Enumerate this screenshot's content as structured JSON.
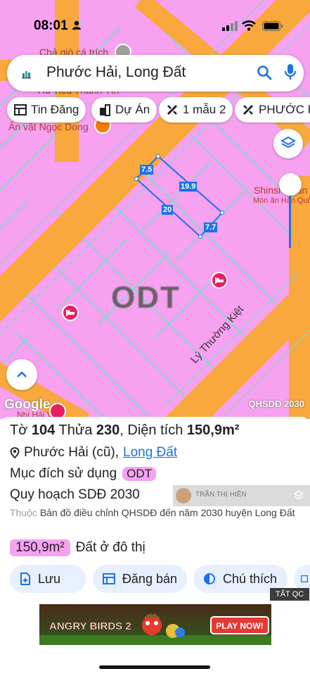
{
  "status": {
    "time": "08:01"
  },
  "search": {
    "text": "Phước Hải, Long Đất"
  },
  "chips": [
    {
      "label": "Tin Đăng"
    },
    {
      "label": "Dự Án"
    },
    {
      "label": "1 mẫu 2"
    },
    {
      "label": "PHƯỚC H"
    }
  ],
  "map": {
    "labels": {
      "cha_gio": "Chả giò cá trích",
      "hu_tieu": "Hủ Tiếu Thanh Tín",
      "an_vat": "Ăn vặt Ngọc Dong",
      "shinsi": "Shinsi Quán",
      "mon_an": "Món ăn Hàn Quốc",
      "nhi": "Nhi Hải Vy"
    },
    "zone": "ODT",
    "street": "Lý Thường Kiệt",
    "dimensions": {
      "top": "7.5",
      "right_top": "19.9",
      "left": "20",
      "right": "7.7"
    },
    "google": "Google",
    "tag": "QHSDĐ 2030",
    "colors": {
      "land": "#f7a1f1",
      "road": "#f8a83c",
      "grid": "#86d7d2",
      "accent": "#1a73e8"
    }
  },
  "sheet": {
    "to_label": "Tờ",
    "to_value": "104",
    "thua_label": "Thửa",
    "thua_value": "230",
    "dien_tich_label": "Diện tích",
    "dien_tich_value": "150,9m²",
    "location": "Phước Hải (cũ),",
    "location_link": "Long Đất",
    "purpose_label": "Mục đích sử dụng",
    "purpose_value": "ODT",
    "plan": "Quy hoạch SDĐ 2030",
    "source_prefix": "Thuộc",
    "source_text": "Bản đồ điều chỉnh QHSDĐ đến năm 2030 huyện Long Đất",
    "area_badge": "150,9m²",
    "area_desc": "Đất ở đô thị",
    "overlay_name": "TRẦN THỊ HIỀN"
  },
  "buttons": {
    "save": "Lưu",
    "post": "Đăng bán",
    "legend": "Chú thích"
  },
  "ads": {
    "close": "TẮT QC",
    "game_title": "ANGRY BIRDS 2",
    "cta": "PLAY NOW!"
  }
}
